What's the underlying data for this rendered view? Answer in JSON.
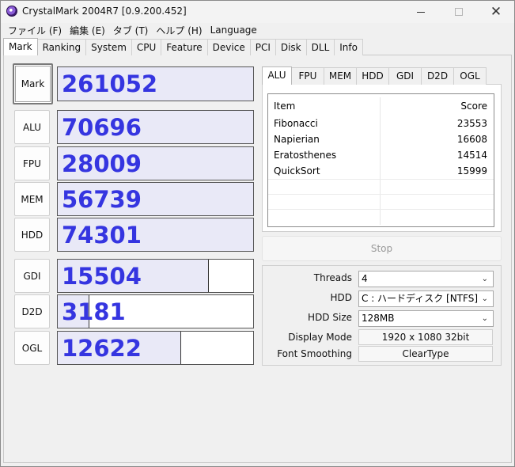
{
  "window": {
    "title": "CrystalMark 2004R7 [0.9.200.452]"
  },
  "menu": [
    "ファイル (F)",
    "編集 (E)",
    "タブ (T)",
    "ヘルプ (H)",
    "Language"
  ],
  "main_tabs": [
    "Mark",
    "Ranking",
    "System",
    "CPU",
    "Feature",
    "Device",
    "PCI",
    "Disk",
    "DLL",
    "Info"
  ],
  "active_main_tab": "Mark",
  "scores": [
    {
      "label": "Mark",
      "value": "261052",
      "fill": 1.0
    },
    {
      "label": "ALU",
      "value": "70696",
      "fill": 1.0
    },
    {
      "label": "FPU",
      "value": "28009",
      "fill": 1.0
    },
    {
      "label": "MEM",
      "value": "56739",
      "fill": 1.0
    },
    {
      "label": "HDD",
      "value": "74301",
      "fill": 1.0
    },
    {
      "label": "GDI",
      "value": "15504",
      "fill": 0.775
    },
    {
      "label": "D2D",
      "value": "3181",
      "fill": 0.16
    },
    {
      "label": "OGL",
      "value": "12622",
      "fill": 0.631
    }
  ],
  "sub_tabs": [
    "ALU",
    "FPU",
    "MEM",
    "HDD",
    "GDI",
    "D2D",
    "OGL"
  ],
  "active_sub_tab": "ALU",
  "results": {
    "columns": [
      "Item",
      "Score"
    ],
    "rows": [
      {
        "item": "Fibonacci",
        "score": "23553"
      },
      {
        "item": "Napierian",
        "score": "16608"
      },
      {
        "item": "Eratosthenes",
        "score": "14514"
      },
      {
        "item": "QuickSort",
        "score": "15999"
      }
    ]
  },
  "stop_button": "Stop",
  "settings": {
    "threads": {
      "label": "Threads",
      "value": "4"
    },
    "hdd": {
      "label": "HDD",
      "value": "C : ハードディスク [NTFS]"
    },
    "hdd_size": {
      "label": "HDD Size",
      "value": "128MB"
    },
    "display_mode": {
      "label": "Display Mode",
      "value": "1920 x 1080 32bit"
    },
    "font_smoothing": {
      "label": "Font Smoothing",
      "value": "ClearType"
    }
  }
}
